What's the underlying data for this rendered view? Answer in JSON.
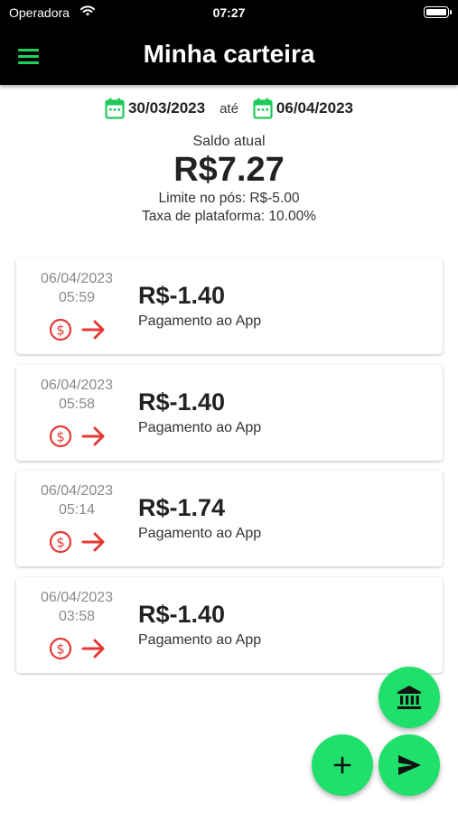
{
  "status_bar": {
    "carrier": "Operadora",
    "time": "07:27"
  },
  "app_bar": {
    "title": "Minha carteira",
    "menu_icon": "menu-icon"
  },
  "date_range": {
    "start": "30/03/2023",
    "separator": "até",
    "end": "06/04/2023"
  },
  "balance": {
    "label": "Saldo atual",
    "value": "R$7.27",
    "limit": "Limite no pós: R$-5.00",
    "fee": "Taxa de plataforma: 10.00%"
  },
  "transactions": [
    {
      "date": "06/04/2023",
      "time": "05:59",
      "amount": "R$-1.40",
      "description": "Pagamento ao App"
    },
    {
      "date": "06/04/2023",
      "time": "05:58",
      "amount": "R$-1.40",
      "description": "Pagamento ao App"
    },
    {
      "date": "06/04/2023",
      "time": "05:14",
      "amount": "R$-1.74",
      "description": "Pagamento ao App"
    },
    {
      "date": "06/04/2023",
      "time": "03:58",
      "amount": "R$-1.40",
      "description": "Pagamento ao App"
    }
  ],
  "fabs": {
    "bank": "bank-icon",
    "add": "plus-icon",
    "send": "send-icon"
  },
  "colors": {
    "accent": "#1ee06a",
    "negative": "#e53935",
    "appbar": "#000000"
  }
}
